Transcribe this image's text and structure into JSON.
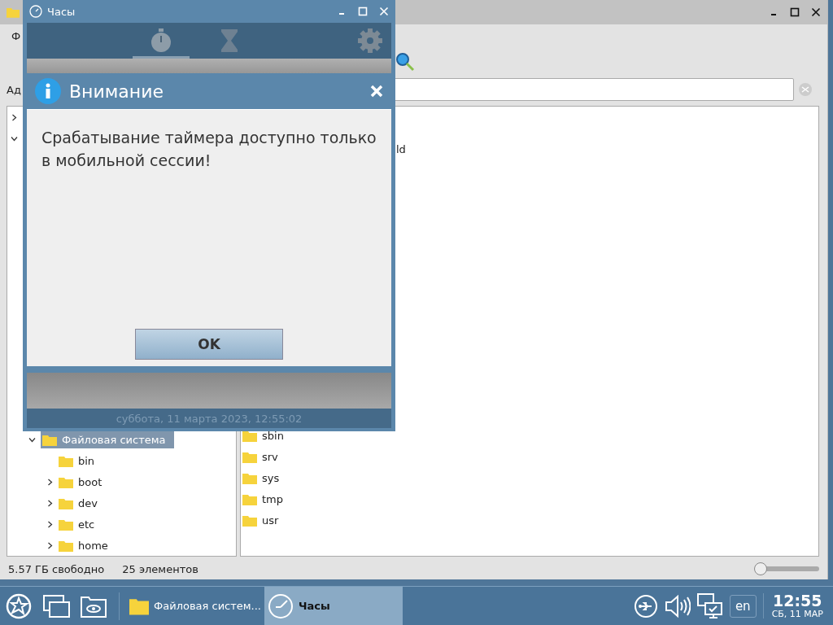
{
  "file_manager": {
    "menu": [
      "Ф"
    ],
    "address_label": "Ад",
    "tree": {
      "top_rows": [
        {
          "expanded": false
        },
        {
          "expanded": true
        }
      ],
      "items": [
        {
          "label": "Файловая система",
          "selected": true,
          "expanded": true,
          "children": [
            {
              "label": "bin",
              "expandable": false
            },
            {
              "label": "boot",
              "expandable": true
            },
            {
              "label": "dev",
              "expandable": true
            },
            {
              "label": "etc",
              "expandable": true
            },
            {
              "label": "home",
              "expandable": true
            }
          ]
        }
      ]
    },
    "files_top": [
      {
        "label": "ld"
      }
    ],
    "files": [
      {
        "label": "sbin"
      },
      {
        "label": "srv"
      },
      {
        "label": "sys"
      },
      {
        "label": "tmp"
      },
      {
        "label": "usr"
      }
    ],
    "status_bar": {
      "free": "5.57 ГБ свободно",
      "count": "25 элементов"
    },
    "zoom_slider": {
      "level": 0
    }
  },
  "clock_window": {
    "title": "Часы",
    "tabs": [
      {
        "kind": "stopwatch",
        "selected": true
      },
      {
        "kind": "timer",
        "selected": false
      }
    ],
    "dialog": {
      "title": "Внимание",
      "message": "Срабатывание таймера доступно только в мобильной сессии!",
      "button": "OK"
    },
    "footer": "суббота, 11 марта 2023, 12:55:02"
  },
  "taskbar": {
    "tasks": [
      {
        "kind": "folder",
        "label": "Файловая систем...",
        "selected": false
      },
      {
        "kind": "clock",
        "label": "Часы",
        "selected": true
      }
    ],
    "language": "en",
    "time": "12:55",
    "date": "СБ, 11 МАР"
  }
}
